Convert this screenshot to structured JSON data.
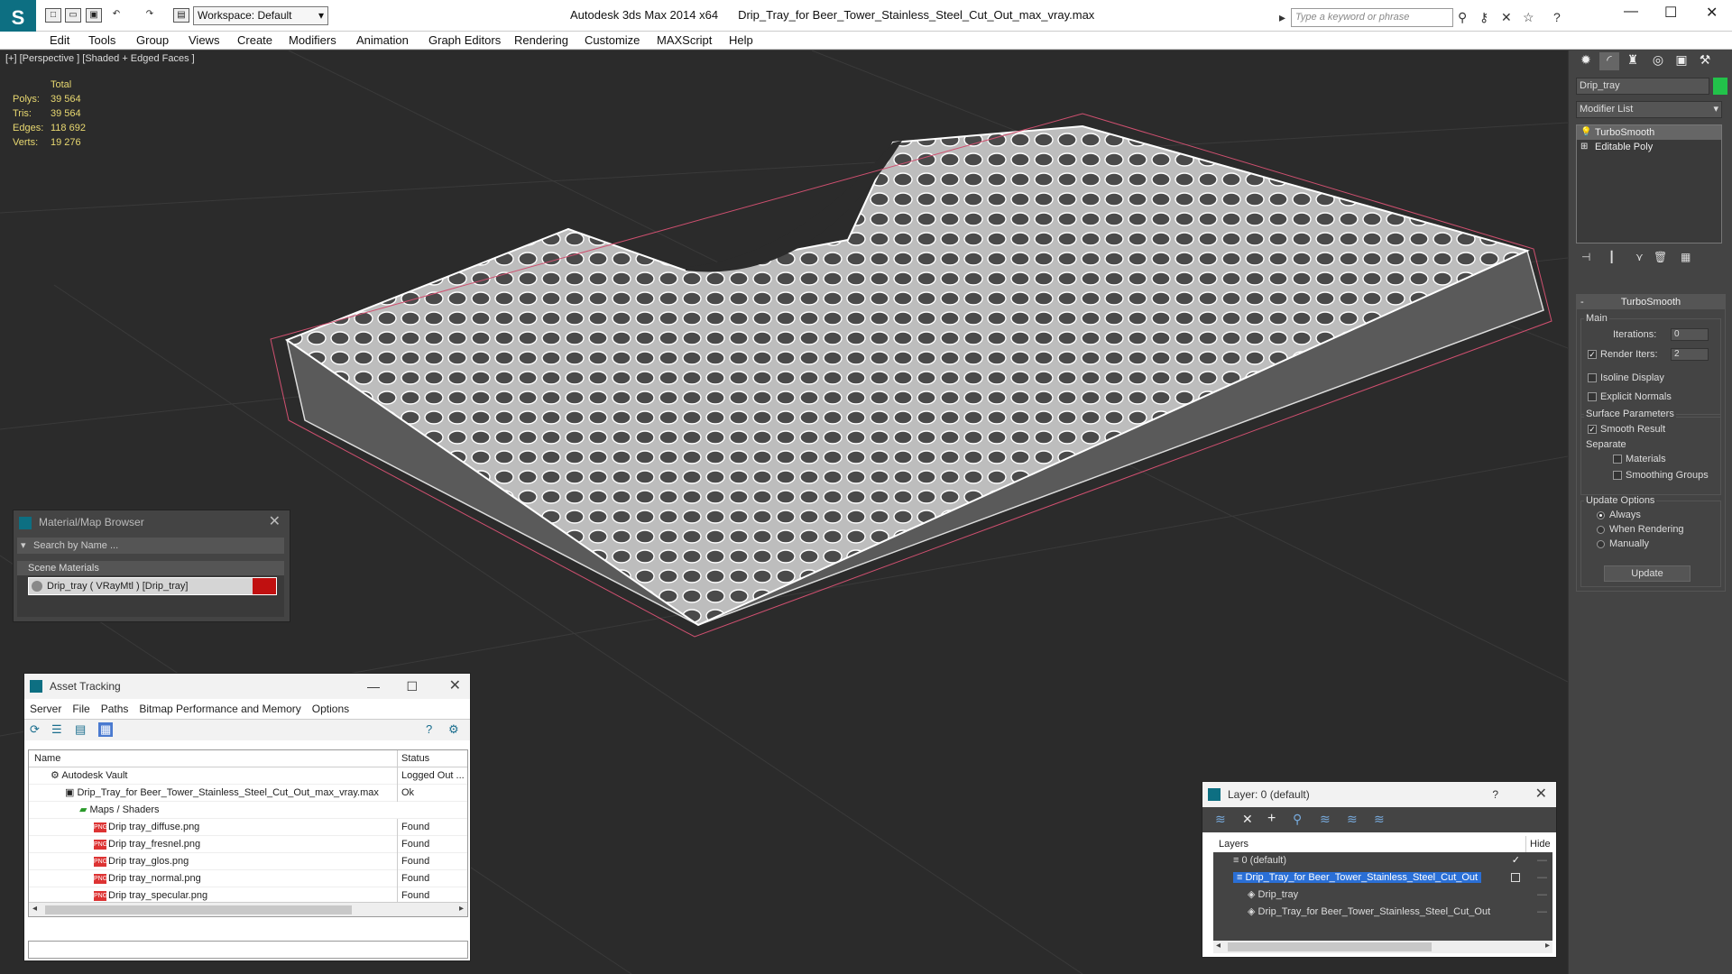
{
  "app": {
    "title": "Autodesk 3ds Max  2014 x64",
    "file": "Drip_Tray_for Beer_Tower_Stainless_Steel_Cut_Out_max_vray.max",
    "workspace": "Workspace: Default",
    "search_placeholder": "Type a keyword or phrase"
  },
  "menu": [
    "Edit",
    "Tools",
    "Group",
    "Views",
    "Create",
    "Modifiers",
    "Animation",
    "Graph Editors",
    "Rendering",
    "Customize",
    "MAXScript",
    "Help"
  ],
  "viewport": {
    "label": "[+] [Perspective ] [Shaded + Edged Faces ]",
    "stats_header": "Total",
    "stats": [
      {
        "k": "Polys:",
        "v": "39 564"
      },
      {
        "k": "Tris:",
        "v": "39 564"
      },
      {
        "k": "Edges:",
        "v": "118 692"
      },
      {
        "k": "Verts:",
        "v": "19 276"
      }
    ]
  },
  "command_panel": {
    "object_name": "Drip_tray",
    "modifier_list": "Modifier List",
    "stack": [
      "TurboSmooth",
      "Editable Poly"
    ],
    "rollout_title": "TurboSmooth",
    "main": "Main",
    "iterations_label": "Iterations:",
    "iterations": "0",
    "render_iters_label": "Render Iters:",
    "render_iters": "2",
    "isoline": "Isoline Display",
    "explicit": "Explicit Normals",
    "surface": "Surface Parameters",
    "smooth_result": "Smooth Result",
    "separate": "Separate",
    "materials": "Materials",
    "smoothing_groups": "Smoothing Groups",
    "update_options": "Update Options",
    "always": "Always",
    "when_rendering": "When Rendering",
    "manually": "Manually",
    "update": "Update"
  },
  "material_browser": {
    "title": "Material/Map Browser",
    "search": "Search by Name ...",
    "section": "Scene Materials",
    "item": "Drip_tray  ( VRayMtl ) [Drip_tray]"
  },
  "asset_tracking": {
    "title": "Asset Tracking",
    "menu": [
      "Server",
      "File",
      "Paths",
      "Bitmap Performance and Memory",
      "Options"
    ],
    "col_name": "Name",
    "col_status": "Status",
    "rows": [
      {
        "name": "Autodesk Vault",
        "status": "Logged Out ..."
      },
      {
        "name": "Drip_Tray_for Beer_Tower_Stainless_Steel_Cut_Out_max_vray.max",
        "status": "Ok"
      },
      {
        "name": "Maps / Shaders",
        "status": ""
      },
      {
        "name": "Drip tray_diffuse.png",
        "status": "Found"
      },
      {
        "name": "Drip tray_fresnel.png",
        "status": "Found"
      },
      {
        "name": "Drip tray_glos.png",
        "status": "Found"
      },
      {
        "name": "Drip tray_normal.png",
        "status": "Found"
      },
      {
        "name": "Drip tray_specular.png",
        "status": "Found"
      }
    ]
  },
  "layer_panel": {
    "title": "Layer: 0 (default)",
    "help": "?",
    "col_layers": "Layers",
    "col_hide": "Hide",
    "rows": [
      "0 (default)",
      "Drip_Tray_for Beer_Tower_Stainless_Steel_Cut_Out",
      "Drip_tray",
      "Drip_Tray_for Beer_Tower_Stainless_Steel_Cut_Out"
    ]
  }
}
